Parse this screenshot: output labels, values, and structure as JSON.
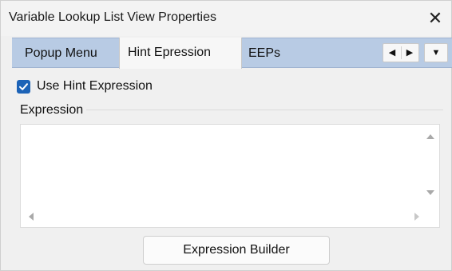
{
  "window": {
    "title": "Variable Lookup List View Properties",
    "close_glyph": "✕"
  },
  "tabs": {
    "items": [
      {
        "label": "Popup Menu",
        "active": false
      },
      {
        "label": "Hint Epression",
        "active": true
      },
      {
        "label": "EEPs",
        "active": false
      }
    ],
    "nav_left_glyph": "◀",
    "nav_right_glyph": "▶",
    "menu_glyph": "▼"
  },
  "options": {
    "use_hint_label": "Use Hint Expression",
    "use_hint_checked": true
  },
  "expression": {
    "group_label": "Expression",
    "value": ""
  },
  "actions": {
    "builder_label": "Expression Builder"
  },
  "colors": {
    "accent": "#1c63b7",
    "tab_strip": "#b8cbe4",
    "window_bg": "#f0f0f0"
  },
  "icons": {
    "close": "close-icon",
    "checkbox": "checkmark-icon",
    "nav_left": "arrow-left-icon",
    "nav_right": "arrow-right-icon",
    "menu": "chevron-down-icon"
  }
}
